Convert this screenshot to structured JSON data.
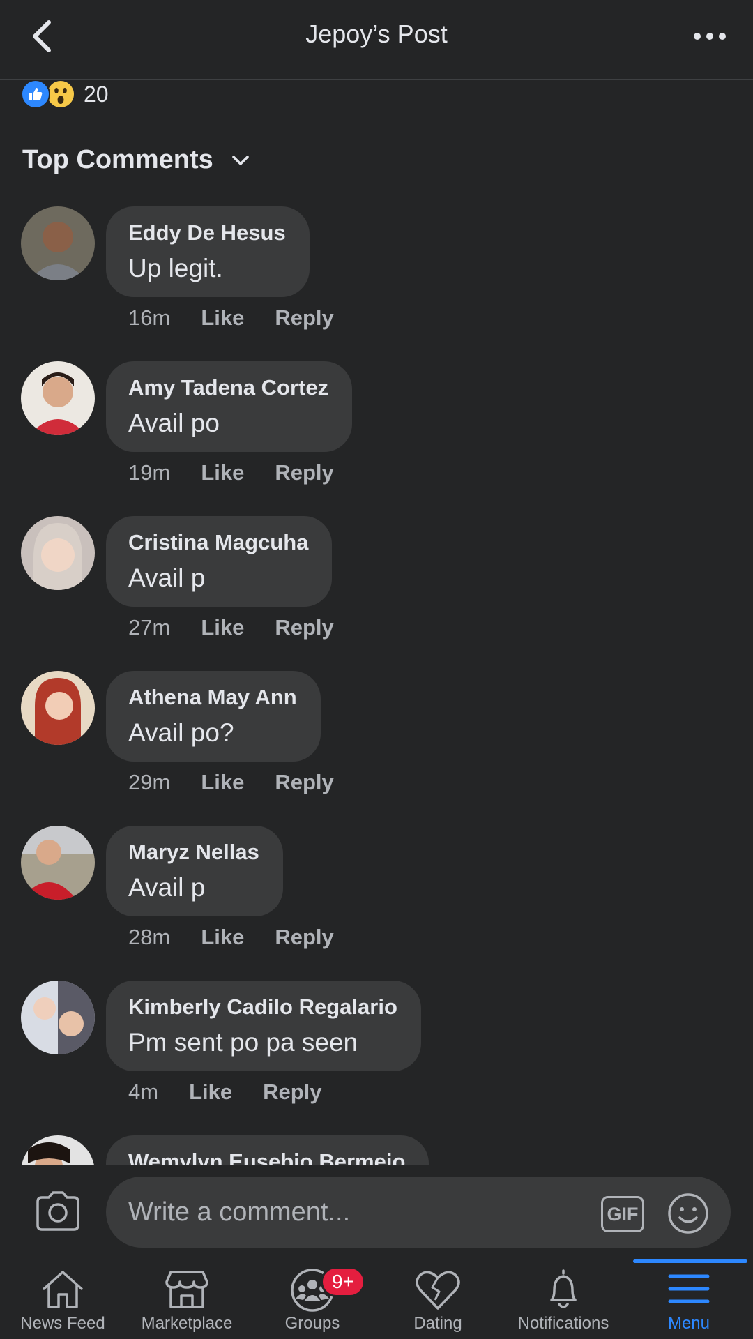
{
  "header": {
    "title": "Jepoy’s Post"
  },
  "reactions": {
    "count": "20"
  },
  "comments_header": {
    "label": "Top Comments"
  },
  "comments": [
    {
      "author": "Eddy De Hesus",
      "text": "Up legit.",
      "time": "16m",
      "like": "Like",
      "reply": "Reply"
    },
    {
      "author": "Amy Tadena Cortez",
      "text": "Avail po",
      "time": "19m",
      "like": "Like",
      "reply": "Reply"
    },
    {
      "author": "Cristina Magcuha",
      "text": "Avail p",
      "time": "27m",
      "like": "Like",
      "reply": "Reply"
    },
    {
      "author": "Athena May Ann",
      "text": "Avail po?",
      "time": "29m",
      "like": "Like",
      "reply": "Reply"
    },
    {
      "author": "Maryz Nellas",
      "text": "Avail p",
      "time": "28m",
      "like": "Like",
      "reply": "Reply"
    },
    {
      "author": "Kimberly Cadilo Regalario",
      "text": "Pm sent po pa seen",
      "time": "4m",
      "like": "Like",
      "reply": "Reply"
    },
    {
      "author": "Wemylyn Eusebio Bermejo",
      "text": "",
      "time": "",
      "like": "",
      "reply": ""
    }
  ],
  "composer": {
    "placeholder": "Write a comment...",
    "gif_label": "GIF"
  },
  "nav": {
    "items": [
      {
        "label": "News Feed",
        "icon": "home-icon"
      },
      {
        "label": "Marketplace",
        "icon": "marketplace-icon"
      },
      {
        "label": "Groups",
        "icon": "groups-icon",
        "badge": "9+"
      },
      {
        "label": "Dating",
        "icon": "heart-icon"
      },
      {
        "label": "Notifications",
        "icon": "bell-icon"
      },
      {
        "label": "Menu",
        "icon": "menu-icon",
        "active": true
      }
    ]
  },
  "colors": {
    "background": "#242526",
    "bubble": "#3a3b3c",
    "accent": "#2d88ff",
    "badge": "#e41e3f",
    "muted": "#b0b3b8"
  }
}
